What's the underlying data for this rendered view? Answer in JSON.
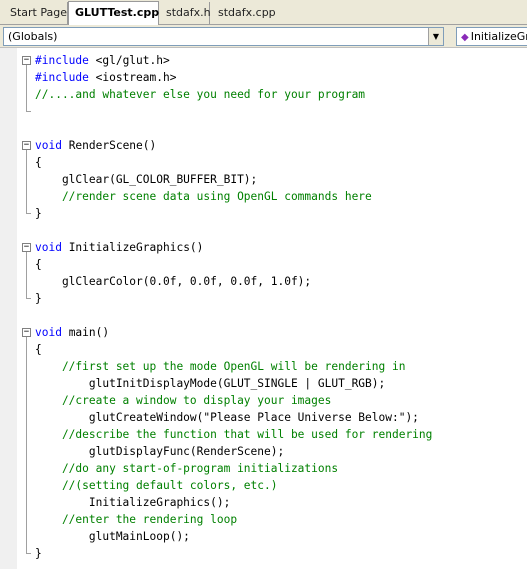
{
  "tabs": [
    {
      "label": "Start Page"
    },
    {
      "label": "GLUTTest.cpp",
      "active": true
    },
    {
      "label": "stdafx.h"
    },
    {
      "label": "stdafx.cpp"
    }
  ],
  "navbar": {
    "scope_dropdown": "(Globals)",
    "member_dropdown": "InitializeGra",
    "member_icon": "function-icon"
  },
  "colors": {
    "keyword": "#0000ff",
    "comment": "#008000",
    "text": "#000000"
  },
  "code_lines": [
    {
      "text": "#include <gl/glut.h>",
      "type": "preprocessor"
    },
    {
      "text": "#include <iostream.h>",
      "type": "preprocessor"
    },
    {
      "text": "//....and whatever else you need for your program",
      "type": "comment"
    },
    {
      "text": "",
      "type": "blank"
    },
    {
      "text": "",
      "type": "blank"
    },
    {
      "text": "void RenderScene()",
      "type": "keyword-decl"
    },
    {
      "text": "{",
      "type": "code"
    },
    {
      "text": "    glClear(GL_COLOR_BUFFER_BIT);",
      "type": "code"
    },
    {
      "text": "    //render scene data using OpenGL commands here",
      "type": "comment"
    },
    {
      "text": "}",
      "type": "code"
    },
    {
      "text": "",
      "type": "blank"
    },
    {
      "text": "void InitializeGraphics()",
      "type": "keyword-decl"
    },
    {
      "text": "{",
      "type": "code"
    },
    {
      "text": "    glClearColor(0.0f, 0.0f, 0.0f, 1.0f);",
      "type": "code"
    },
    {
      "text": "}",
      "type": "code"
    },
    {
      "text": "",
      "type": "blank"
    },
    {
      "text": "void main()",
      "type": "keyword-decl"
    },
    {
      "text": "{",
      "type": "code"
    },
    {
      "text": "    //first set up the mode OpenGL will be rendering in",
      "type": "comment"
    },
    {
      "text": "        glutInitDisplayMode(GLUT_SINGLE | GLUT_RGB);",
      "type": "code"
    },
    {
      "text": "    //create a window to display your images",
      "type": "comment"
    },
    {
      "text": "        glutCreateWindow(\"Please Place Universe Below:\");",
      "type": "code"
    },
    {
      "text": "    //describe the function that will be used for rendering",
      "type": "comment"
    },
    {
      "text": "        glutDisplayFunc(RenderScene);",
      "type": "code"
    },
    {
      "text": "    //do any start-of-program initializations",
      "type": "comment"
    },
    {
      "text": "    //(setting default colors, etc.)",
      "type": "comment"
    },
    {
      "text": "        InitializeGraphics();",
      "type": "code"
    },
    {
      "text": "    //enter the rendering loop",
      "type": "comment"
    },
    {
      "text": "        glutMainLoop();",
      "type": "code"
    },
    {
      "text": "}",
      "type": "code"
    }
  ]
}
